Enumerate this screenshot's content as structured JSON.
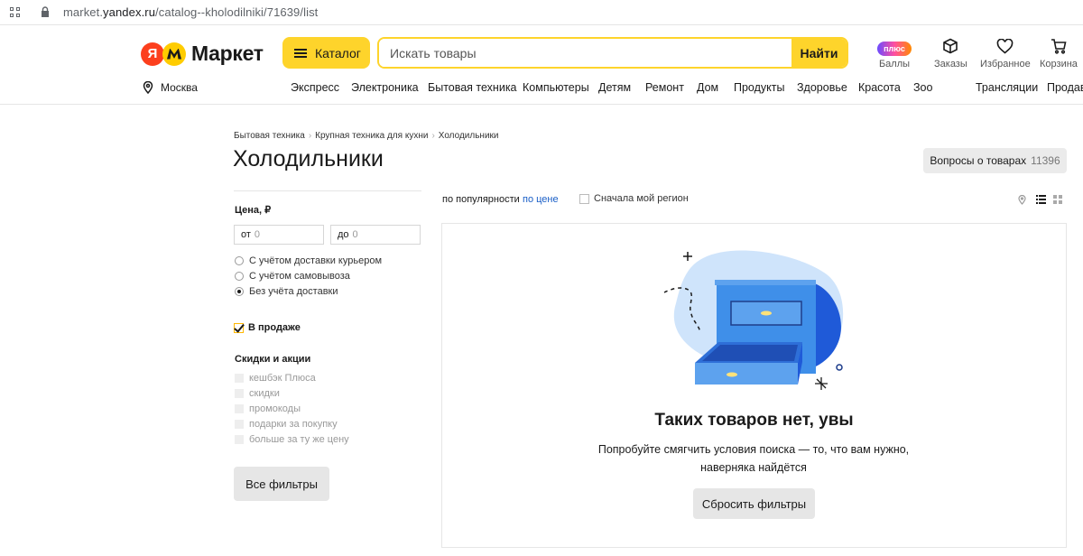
{
  "browser": {
    "url_prefix": "market.",
    "url_domain": "yandex.ru",
    "url_path": "/catalog--kholodilniki/71639/list"
  },
  "header": {
    "logo_text": "Маркет",
    "catalog_label": "Каталог",
    "search_placeholder": "Искать товары",
    "search_button": "Найти",
    "plus_badge": "плюс",
    "icons": [
      {
        "name": "points",
        "label": "Баллы"
      },
      {
        "name": "orders",
        "label": "Заказы"
      },
      {
        "name": "favorites",
        "label": "Избранное"
      },
      {
        "name": "cart",
        "label": "Корзина"
      }
    ],
    "region": "Москва",
    "nav": [
      "Экспресс",
      "Электроника",
      "Бытовая техника",
      "Компьютеры",
      "Детям",
      "Ремонт",
      "Дом",
      "Продукты",
      "Здоровье",
      "Красота",
      "Зоо",
      "Трансляции",
      "Продав"
    ]
  },
  "breadcrumbs": [
    "Бытовая техника",
    "Крупная техника для кухни",
    "Холодильники"
  ],
  "page_title": "Холодильники",
  "questions": {
    "label": "Вопросы о товарах",
    "count": "11396"
  },
  "filters": {
    "price_title": "Цена, ₽",
    "price_from_label": "от",
    "price_from_placeholder": "0",
    "price_to_label": "до",
    "price_to_placeholder": "0",
    "delivery_options": [
      {
        "label": "С учётом доставки курьером",
        "selected": false
      },
      {
        "label": "С учётом самовывоза",
        "selected": false
      },
      {
        "label": "Без учёта доставки",
        "selected": true
      }
    ],
    "on_sale_label": "В продаже",
    "on_sale_checked": true,
    "discounts_title": "Скидки и акции",
    "discount_options": [
      "кешбэк Плюса",
      "скидки",
      "промокоды",
      "подарки за покупку",
      "больше за ту же цену"
    ],
    "all_filters": "Все фильтры"
  },
  "sorting": {
    "active": "по популярности",
    "price_link": "по цене",
    "my_region_label": "Сначала мой регион"
  },
  "empty_state": {
    "title": "Таких товаров нет, увы",
    "text": "Попробуйте смягчить условия поиска — то, что вам нужно, наверняка найдётся",
    "reset_button": "Сбросить фильтры"
  },
  "colors": {
    "accent_yellow": "#fed42b",
    "logo_red": "#fc3f1d",
    "link_blue": "#1a5fc7",
    "illustration_blue": "#3f8fe9"
  }
}
